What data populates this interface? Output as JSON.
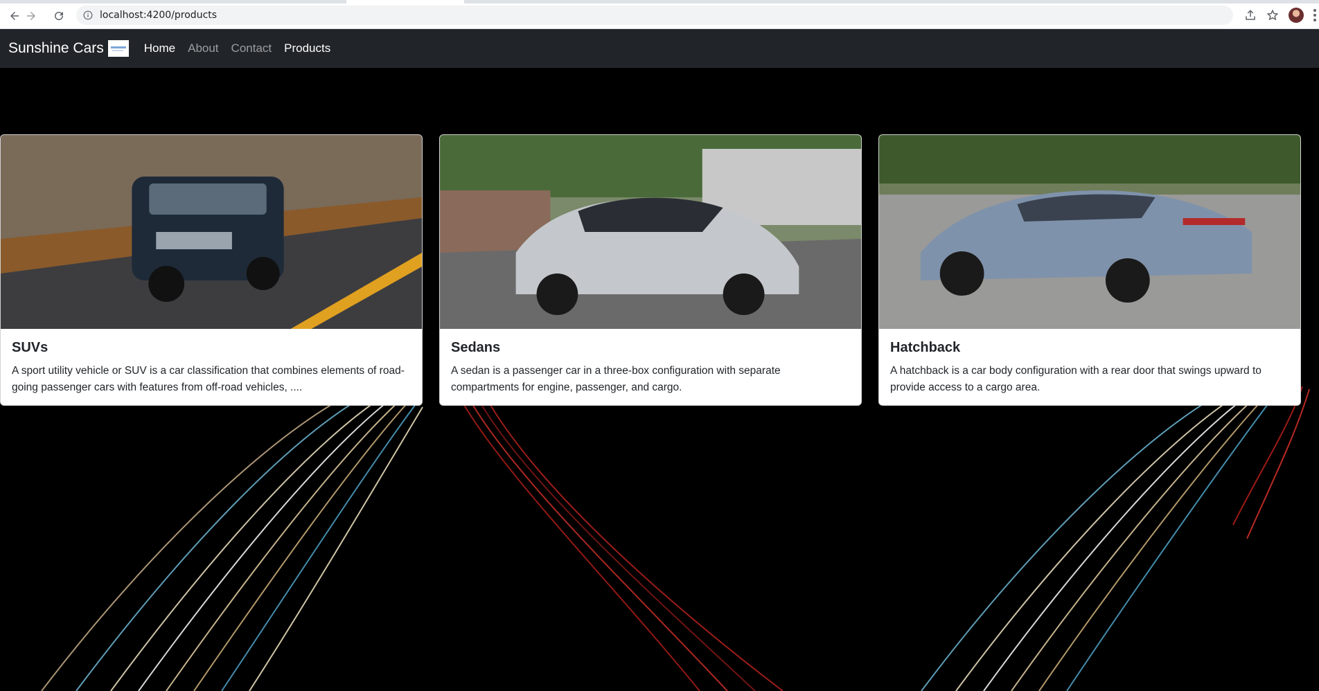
{
  "browser": {
    "url": "localhost:4200/products",
    "back_icon": "arrow-left-icon",
    "forward_icon": "arrow-right-icon",
    "reload_icon": "reload-icon",
    "info_icon": "info-icon",
    "share_icon": "share-icon",
    "bookmark_icon": "star-icon",
    "menu_icon": "kebab-menu-icon"
  },
  "navbar": {
    "brand": "Sunshine Cars",
    "links": [
      {
        "label": "Home",
        "active": true
      },
      {
        "label": "About",
        "active": false
      },
      {
        "label": "Contact",
        "active": false
      },
      {
        "label": "Products",
        "active": true
      }
    ]
  },
  "cards": [
    {
      "title": "SUVs",
      "text": "A sport utility vehicle or SUV is a car classification that combines elements of road-going passenger cars with features from off-road vehicles, ...."
    },
    {
      "title": "Sedans",
      "text": "A sedan is a passenger car in a three-box configuration with separate compartments for engine, passenger, and cargo."
    },
    {
      "title": "Hatchback",
      "text": "A hatchback is a car body configuration with a rear door that swings upward to provide access to a cargo area."
    }
  ],
  "colors": {
    "navbar_bg": "#212529",
    "page_bg": "#000000",
    "card_bg": "#ffffff",
    "text": "#212529"
  }
}
